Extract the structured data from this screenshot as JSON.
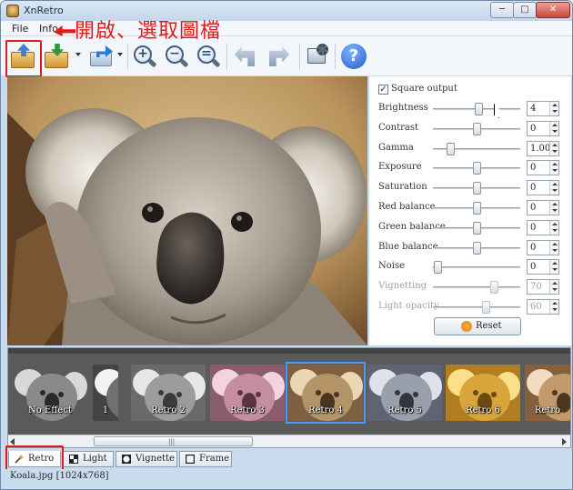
{
  "window": {
    "title": "XnRetro",
    "minimize_label": "─",
    "maximize_label": "□",
    "close_label": "✕"
  },
  "menubar": {
    "items": [
      "File",
      "Info"
    ]
  },
  "annotation": {
    "text": "開啟、選取圖檔",
    "color": "#e11a1a"
  },
  "toolbar": {
    "help_label": "?",
    "zoom_in_symbol": "+",
    "zoom_out_symbol": "−",
    "zoom_fit_symbol": "="
  },
  "adjustments": {
    "square_output_label": "Square output",
    "square_output_checked": true,
    "checkmark": "✓",
    "sliders": [
      {
        "label": "Brightness",
        "value": "4",
        "level": 0.52,
        "enabled": true
      },
      {
        "label": "Contrast",
        "value": "0",
        "level": 0.5,
        "enabled": true
      },
      {
        "label": "Gamma",
        "value": "1.00",
        "level": 0.2,
        "enabled": true
      },
      {
        "label": "Exposure",
        "value": "0",
        "level": 0.5,
        "enabled": true
      },
      {
        "label": "Saturation",
        "value": "0",
        "level": 0.5,
        "enabled": true
      },
      {
        "label": "Red balance",
        "value": "0",
        "level": 0.5,
        "enabled": true
      },
      {
        "label": "Green balance",
        "value": "0",
        "level": 0.5,
        "enabled": true
      },
      {
        "label": "Blue balance",
        "value": "0",
        "level": 0.5,
        "enabled": true
      },
      {
        "label": "Noise",
        "value": "0",
        "level": 0.05,
        "enabled": true
      },
      {
        "label": "Vignetting",
        "value": "70",
        "level": 0.7,
        "enabled": false
      },
      {
        "label": "Light opacity",
        "value": "60",
        "level": 0.6,
        "enabled": false
      }
    ],
    "reset_label": "Reset"
  },
  "filmstrip": {
    "items": [
      {
        "label": "No Effect",
        "tint": "grayscale",
        "selected": false
      },
      {
        "label": "1",
        "tint": "bw-hard",
        "selected": false
      },
      {
        "label": "Retro 2",
        "tint": "gray-soft",
        "selected": false
      },
      {
        "label": "Retro 3",
        "tint": "pink",
        "selected": false
      },
      {
        "label": "Retro 4",
        "tint": "sepia",
        "selected": true
      },
      {
        "label": "Retro 5",
        "tint": "cool-gray",
        "selected": false
      },
      {
        "label": "Retro 6",
        "tint": "gold",
        "selected": false
      },
      {
        "label": "Retro",
        "tint": "warm",
        "selected": false
      }
    ],
    "scroll_grip": "|||"
  },
  "tabs": [
    {
      "label": "Retro",
      "icon": "wand-icon",
      "active": true
    },
    {
      "label": "Light",
      "icon": "light-icon",
      "active": false
    },
    {
      "label": "Vignette",
      "icon": "vignette-icon",
      "active": false
    },
    {
      "label": "Frame",
      "icon": "frame-icon",
      "active": false
    }
  ],
  "status": {
    "text": "Koala.jpg [1024x768]"
  }
}
